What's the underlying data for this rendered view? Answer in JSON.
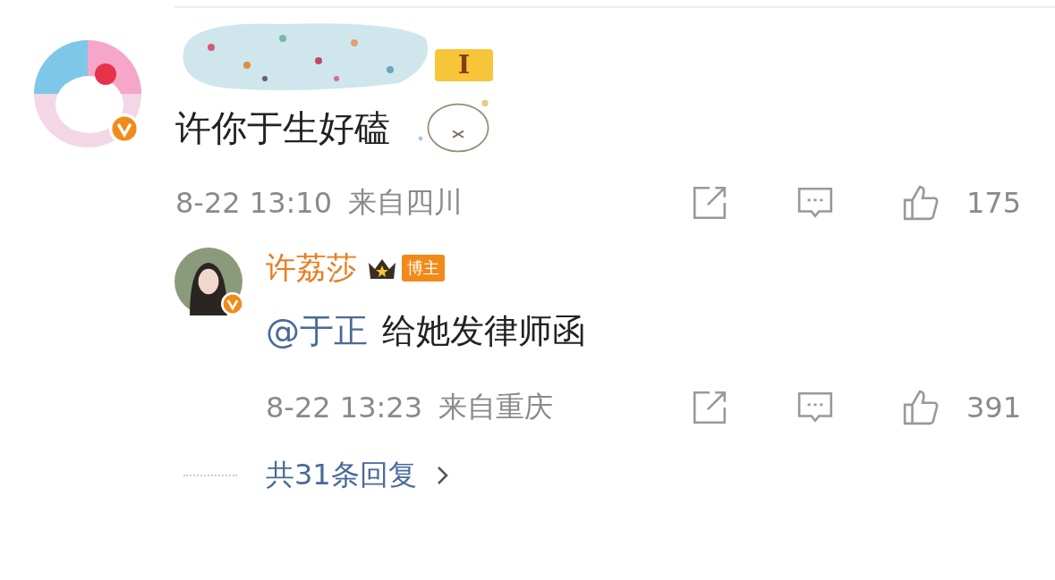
{
  "comment": {
    "verified": true,
    "level_badge": "I",
    "text": "许你于生好磕",
    "time": "8-22 13:10",
    "location": "来自四川",
    "likes": "175"
  },
  "reply": {
    "verified": true,
    "author": "许荔莎",
    "badge": "博主",
    "mention": "@于正",
    "text": "给她发律师函",
    "time": "8-22 13:23",
    "location": "来自重庆",
    "likes": "391"
  },
  "more_replies": "共31条回复"
}
